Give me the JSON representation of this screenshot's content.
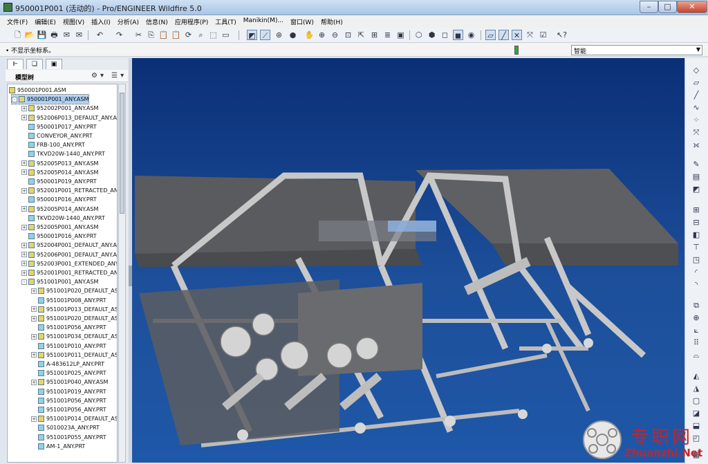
{
  "window": {
    "title": "950001P001 (活动的) - Pro/ENGINEER Wildfire 5.0",
    "min": "–",
    "max": "□",
    "close": "✕"
  },
  "menu": [
    "文件(F)",
    "编辑(E)",
    "视图(V)",
    "插入(I)",
    "分析(A)",
    "信息(N)",
    "应用程序(P)",
    "工具(T)",
    "Manikin(M)...",
    "窗口(W)",
    "帮助(H)"
  ],
  "message": "• 不显示坐标系。",
  "filter": {
    "value": "智能"
  },
  "panel": {
    "title": "模型树",
    "tabs": [
      "tree-tab",
      "layer-tab",
      "folder-tab"
    ]
  },
  "tree": [
    {
      "label": "950001P001.ASM",
      "type": "asm",
      "level": 0,
      "expander": false,
      "selected": false
    },
    {
      "label": "950001P001_ANY.ASM",
      "type": "asm",
      "level": 1,
      "expander": true,
      "sign": "-",
      "selected": true
    },
    {
      "label": "952002P001_ANY.ASM",
      "type": "asm",
      "level": 2,
      "expander": true,
      "sign": "+",
      "selected": false
    },
    {
      "label": "952006P013_DEFAULT_ANY.AS",
      "type": "asm",
      "level": 2,
      "expander": true,
      "sign": "+",
      "selected": false
    },
    {
      "label": "950001P017_ANY.PRT",
      "type": "prt",
      "level": 2,
      "expander": false,
      "selected": false
    },
    {
      "label": "CONVEYOR_ANY.PRT",
      "type": "prt",
      "level": 2,
      "expander": false,
      "selected": false
    },
    {
      "label": "FRB-100_ANY.PRT",
      "type": "prt",
      "level": 2,
      "expander": false,
      "selected": false
    },
    {
      "label": "TKVD20W-1440_ANY.PRT",
      "type": "prt",
      "level": 2,
      "expander": false,
      "selected": false
    },
    {
      "label": "952005P013_ANY.ASM",
      "type": "asm",
      "level": 2,
      "expander": true,
      "sign": "+",
      "selected": false
    },
    {
      "label": "952005P014_ANY.ASM",
      "type": "asm",
      "level": 2,
      "expander": true,
      "sign": "+",
      "selected": false
    },
    {
      "label": "950001P019_ANY.PRT",
      "type": "prt",
      "level": 2,
      "expander": false,
      "selected": false
    },
    {
      "label": "952001P001_RETRACTED_ANY",
      "type": "asm",
      "level": 2,
      "expander": true,
      "sign": "+",
      "selected": false
    },
    {
      "label": "950001P016_ANY.PRT",
      "type": "prt",
      "level": 2,
      "expander": false,
      "selected": false
    },
    {
      "label": "952005P014_ANY.ASM",
      "type": "asm",
      "level": 2,
      "expander": true,
      "sign": "+",
      "selected": false
    },
    {
      "label": "TKVD20W-1440_ANY.PRT",
      "type": "prt",
      "level": 2,
      "expander": false,
      "selected": false
    },
    {
      "label": "952005P001_ANY.ASM",
      "type": "asm",
      "level": 2,
      "expander": true,
      "sign": "+",
      "selected": false
    },
    {
      "label": "950001P016_ANY.PRT",
      "type": "prt",
      "level": 2,
      "expander": false,
      "selected": false
    },
    {
      "label": "952004P001_DEFAULT_ANY.AS",
      "type": "asm",
      "level": 2,
      "expander": true,
      "sign": "+",
      "selected": false
    },
    {
      "label": "952006P001_DEFAULT_ANY.AS",
      "type": "asm",
      "level": 2,
      "expander": true,
      "sign": "+",
      "selected": false
    },
    {
      "label": "952003P001_EXTENDED_ANY.",
      "type": "asm",
      "level": 2,
      "expander": true,
      "sign": "+",
      "selected": false
    },
    {
      "label": "952001P001_RETRACTED_ANY",
      "type": "asm",
      "level": 2,
      "expander": true,
      "sign": "+",
      "selected": false
    },
    {
      "label": "951001P001_ANY.ASM",
      "type": "asm",
      "level": 2,
      "expander": true,
      "sign": "-",
      "selected": false
    },
    {
      "label": "951001P020_DEFAULT_AS",
      "type": "asm",
      "level": 3,
      "expander": true,
      "sign": "+",
      "selected": false
    },
    {
      "label": "951001P008_ANY.PRT",
      "type": "prt",
      "level": 3,
      "expander": false,
      "selected": false
    },
    {
      "label": "951001P013_DEFAULT_AS",
      "type": "asm",
      "level": 3,
      "expander": true,
      "sign": "+",
      "selected": false
    },
    {
      "label": "951001P020_DEFAULT_AS",
      "type": "asm",
      "level": 3,
      "expander": true,
      "sign": "+",
      "selected": false
    },
    {
      "label": "951001P056_ANY.PRT",
      "type": "prt",
      "level": 3,
      "expander": false,
      "selected": false
    },
    {
      "label": "951001P034_DEFAULT_AS",
      "type": "asm",
      "level": 3,
      "expander": true,
      "sign": "+",
      "selected": false
    },
    {
      "label": "951001P010_ANY.PRT",
      "type": "prt",
      "level": 3,
      "expander": false,
      "selected": false
    },
    {
      "label": "951001P011_DEFAULT_AS",
      "type": "asm",
      "level": 3,
      "expander": true,
      "sign": "+",
      "selected": false
    },
    {
      "label": "A-483612LP_ANY.PRT",
      "type": "prt",
      "level": 3,
      "expander": false,
      "selected": false
    },
    {
      "label": "951001P025_ANY.PRT",
      "type": "prt",
      "level": 3,
      "expander": false,
      "selected": false
    },
    {
      "label": "951001P040_ANY.ASM",
      "type": "asm",
      "level": 3,
      "expander": true,
      "sign": "+",
      "selected": false
    },
    {
      "label": "951001P019_ANY.PRT",
      "type": "prt",
      "level": 3,
      "expander": false,
      "selected": false
    },
    {
      "label": "951001P056_ANY.PRT",
      "type": "prt",
      "level": 3,
      "expander": false,
      "selected": false
    },
    {
      "label": "951001P056_ANY.PRT",
      "type": "prt",
      "level": 3,
      "expander": false,
      "selected": false
    },
    {
      "label": "951001P014_DEFAULT_AS",
      "type": "asm",
      "level": 3,
      "expander": true,
      "sign": "+",
      "selected": false
    },
    {
      "label": "S010023A_ANY.PRT",
      "type": "prt",
      "level": 3,
      "expander": false,
      "selected": false
    },
    {
      "label": "951001P055_ANY.PRT",
      "type": "prt",
      "level": 3,
      "expander": false,
      "selected": false
    },
    {
      "label": "AM-1_ANY.PRT",
      "type": "prt",
      "level": 3,
      "expander": false,
      "selected": false
    }
  ],
  "watermark": {
    "cn": "专职网",
    "en": "Zhuanzhi.Net"
  },
  "colors": {
    "viewport_top": "#0a2f77",
    "viewport_bottom": "#1e58a8",
    "model_gray": "#9a9a9a",
    "watermark": "#c8222a"
  }
}
